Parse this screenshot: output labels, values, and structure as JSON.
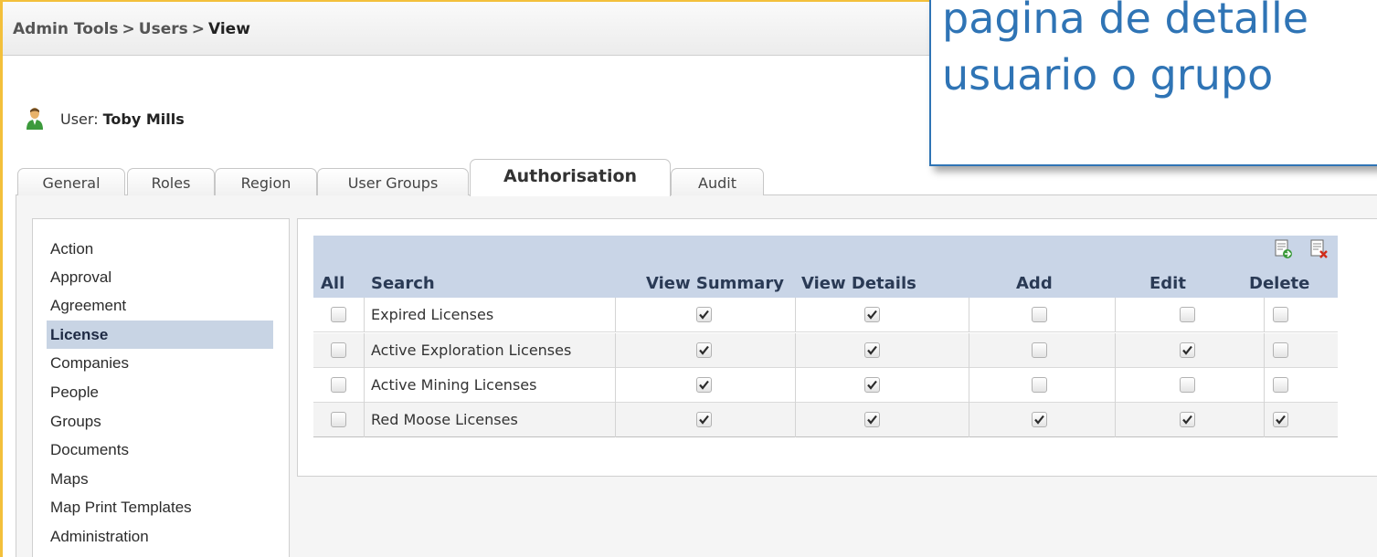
{
  "breadcrumb": {
    "items": [
      "Admin Tools",
      "Users",
      "View"
    ],
    "separator": ">"
  },
  "user": {
    "label": "User:",
    "name": "Toby Mills",
    "icon": "user-icon"
  },
  "tabs": [
    {
      "label": "General",
      "active": false
    },
    {
      "label": "Roles",
      "active": false
    },
    {
      "label": "Region",
      "active": false
    },
    {
      "label": "User Groups",
      "active": false
    },
    {
      "label": "Authorisation",
      "active": true
    },
    {
      "label": "Audit",
      "active": false
    }
  ],
  "categories": [
    {
      "label": "Action",
      "selected": false
    },
    {
      "label": "Approval",
      "selected": false
    },
    {
      "label": "Agreement",
      "selected": false
    },
    {
      "label": "License",
      "selected": true
    },
    {
      "label": "Companies",
      "selected": false
    },
    {
      "label": "People",
      "selected": false
    },
    {
      "label": "Groups",
      "selected": false
    },
    {
      "label": "Documents",
      "selected": false
    },
    {
      "label": "Maps",
      "selected": false
    },
    {
      "label": "Map Print Templates",
      "selected": false
    },
    {
      "label": "Administration",
      "selected": false
    }
  ],
  "permissions": {
    "toolbar": {
      "icons": [
        "export-icon",
        "delete-icon"
      ]
    },
    "columns": [
      "All",
      "Search",
      "View Summary",
      "View Details",
      "Add",
      "Edit",
      "Delete"
    ],
    "rows": [
      {
        "search": "Expired Licenses",
        "all": false,
        "view_summary": true,
        "view_details": true,
        "add": false,
        "edit": false,
        "delete": false
      },
      {
        "search": "Active Exploration Licenses",
        "all": false,
        "view_summary": true,
        "view_details": true,
        "add": false,
        "edit": true,
        "delete": false
      },
      {
        "search": "Active Mining Licenses",
        "all": false,
        "view_summary": true,
        "view_details": true,
        "add": false,
        "edit": false,
        "delete": false
      },
      {
        "search": "Red Moose Licenses",
        "all": false,
        "view_summary": true,
        "view_details": true,
        "add": true,
        "edit": true,
        "delete": true
      }
    ]
  },
  "callout": {
    "lines": [
      "pagina de detalle",
      "usuario o grupo"
    ]
  },
  "colors": {
    "frame_accent": "#f3c03b",
    "header_blue": "#c9d5e7",
    "selected_bg": "#c8d4e4",
    "callout_blue": "#2f74b5"
  }
}
